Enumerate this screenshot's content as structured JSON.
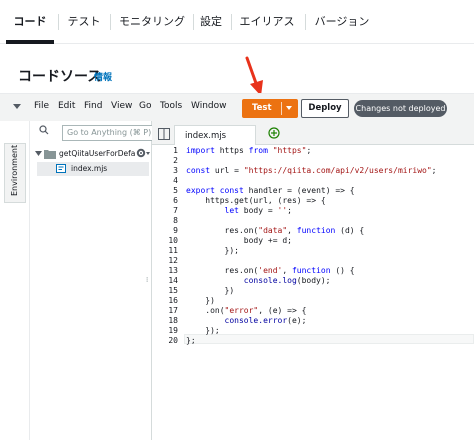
{
  "tabs": [
    {
      "label": "コード",
      "active": true
    },
    {
      "label": "テスト",
      "active": false
    },
    {
      "label": "モニタリング",
      "active": false
    },
    {
      "label": "設定",
      "active": false
    },
    {
      "label": "エイリアス",
      "active": false
    },
    {
      "label": "バージョン",
      "active": false
    }
  ],
  "page": {
    "title": "コードソース",
    "info_link": "情報"
  },
  "toolbar": {
    "menu": [
      "File",
      "Edit",
      "Find",
      "View",
      "Go",
      "Tools",
      "Window"
    ],
    "test_label": "Test",
    "deploy_label": "Deploy",
    "status_badge": "Changes not deployed"
  },
  "environment": {
    "label": "Environment"
  },
  "explorer": {
    "search_placeholder": "Go to Anything (⌘ P)",
    "folder": "getQiitaUserForDefa",
    "file": "index.mjs"
  },
  "editor": {
    "tab_label": "index.mjs",
    "lines": [
      "import https from \"https\";",
      "",
      "const url = \"https://qiita.com/api/v2/users/miriwo\";",
      "",
      "export const handler = (event) => {",
      "    https.get(url, (res) => {",
      "        let body = '';",
      "",
      "        res.on(\"data\", function (d) {",
      "            body += d;",
      "        });",
      "",
      "        res.on('end', function () {",
      "            console.log(body);",
      "        })",
      "    })",
      "    .on(\"error\", (e) => {",
      "        console.error(e);",
      "    });",
      "};"
    ]
  },
  "colors": {
    "accent_orange": "#ec7211",
    "badge_gray": "#545b64",
    "link_blue": "#0073bb",
    "arrow_red": "#e8321b"
  }
}
